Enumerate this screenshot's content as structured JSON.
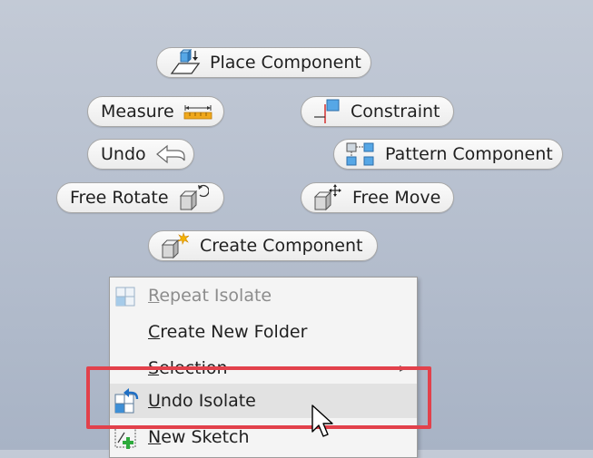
{
  "marking_menu": {
    "place_component": "Place Component",
    "measure": "Measure",
    "constraint": "Constraint",
    "undo": "Undo",
    "pattern_component": "Pattern Component",
    "free_rotate": "Free Rotate",
    "free_move": "Free Move",
    "create_component": "Create Component"
  },
  "context_menu": {
    "items": [
      {
        "label": "Repeat Isolate",
        "mnemonic": "R",
        "enabled": false,
        "icon": "isolate-icon"
      },
      {
        "label": "Create New Folder",
        "mnemonic": "C",
        "enabled": true
      },
      {
        "label": "Selection",
        "mnemonic": "S",
        "enabled": true,
        "submenu": true
      },
      {
        "label": "Undo Isolate",
        "mnemonic": "U",
        "enabled": true,
        "hovered": true,
        "icon": "undo-isolate-icon"
      },
      {
        "label": "New Sketch",
        "mnemonic": "N",
        "enabled": true,
        "icon": "new-sketch-icon"
      }
    ]
  },
  "colors": {
    "highlight_border": "#e2414b",
    "icon_blue": "#3e8fd6",
    "ruler_orange": "#f0a81c"
  }
}
